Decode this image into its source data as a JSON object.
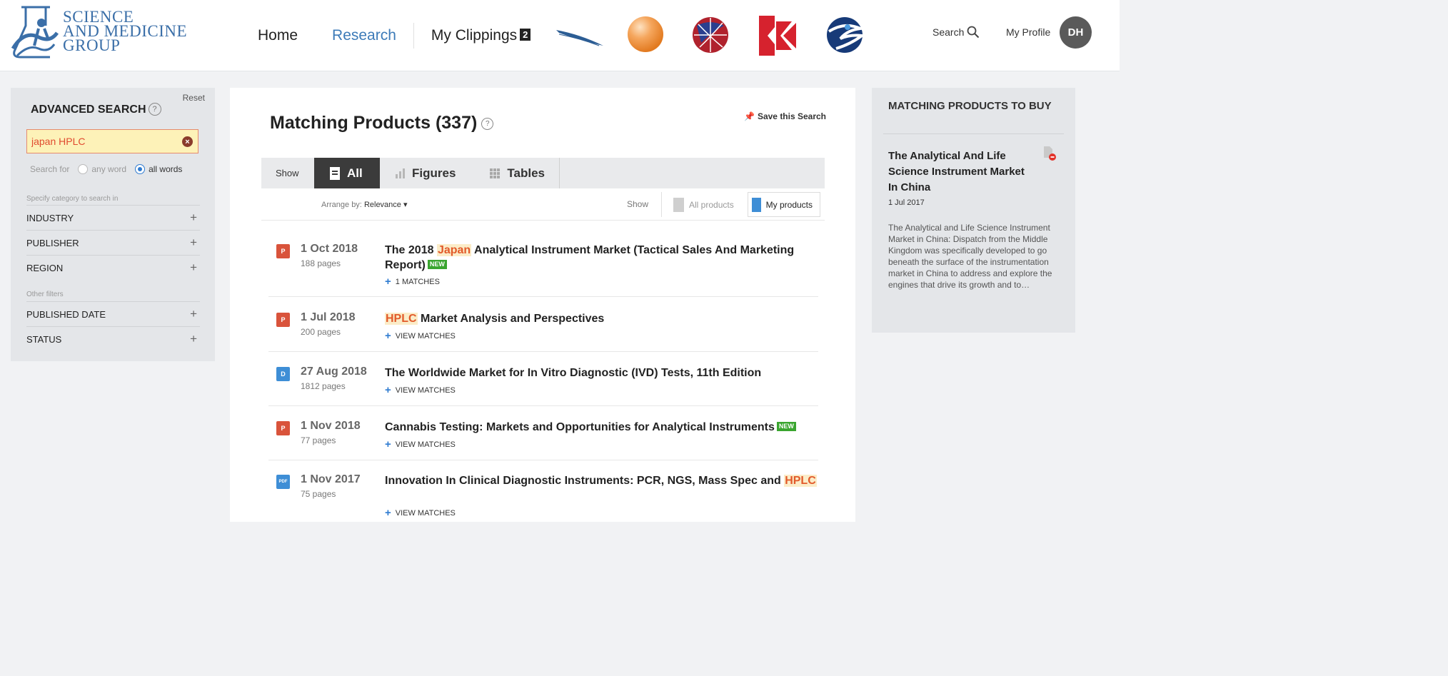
{
  "header": {
    "logo": {
      "line1": "SCIENCE",
      "line2": "AND MEDICINE",
      "line3": "GROUP"
    },
    "nav": {
      "home": "Home",
      "research": "Research",
      "clippings": "My Clippings",
      "clippings_count": "2"
    },
    "brands": [
      "wing-logo",
      "orange-sphere-logo",
      "globe-logo",
      "red-k-logo",
      "blue-swirl-logo"
    ],
    "search_label": "Search",
    "profile_label": "My Profile",
    "avatar_initials": "DH"
  },
  "left_panel": {
    "title": "ADVANCED SEARCH",
    "help": "?",
    "reset": "Reset",
    "search_value": "japan HPLC",
    "clear": "×",
    "search_for_label": "Search for",
    "option_any": "any word",
    "option_all": "all words",
    "category_label": "Specify category to search in",
    "filters": [
      "INDUSTRY",
      "PUBLISHER",
      "REGION"
    ],
    "other_label": "Other filters",
    "other_filters": [
      "PUBLISHED DATE",
      "STATUS"
    ],
    "plus": "+"
  },
  "main": {
    "title": "Matching Products (337)",
    "help": "?",
    "save_search": "Save this Search",
    "tabs": {
      "show": "Show",
      "all": "All",
      "figures": "Figures",
      "tables": "Tables"
    },
    "arrange_label": "Arrange by:",
    "arrange_value": "Relevance ▾",
    "show_label": "Show",
    "all_products": "All products",
    "my_products": "My products",
    "results": [
      {
        "type": "P",
        "date": "1 Oct 2018",
        "pages": "188 pages",
        "title_before": "The 2018 ",
        "title_hl": "Japan",
        "title_after": " Analytical Instrument Market (Tactical Sales And Marketing Report)",
        "new": "NEW",
        "matches": "1 MATCHES"
      },
      {
        "type": "P",
        "date": "1 Jul 2018",
        "pages": "200 pages",
        "title_hl": "HPLC",
        "title_after": " Market Analysis and Perspectives",
        "matches": "VIEW MATCHES"
      },
      {
        "type": "D",
        "date": "27 Aug 2018",
        "pages": "1812 pages",
        "title": "The Worldwide Market for In Vitro Diagnostic (IVD) Tests, 11th Edition",
        "matches": "VIEW MATCHES"
      },
      {
        "type": "P",
        "date": "1 Nov 2018",
        "pages": "77 pages",
        "title": "Cannabis Testing: Markets and Opportunities for Analytical Instruments",
        "new": "NEW",
        "matches": "VIEW MATCHES"
      },
      {
        "type": "PDF",
        "date": "1 Nov 2017",
        "pages": "75 pages",
        "title": "Innovation In Clinical Diagnostic Instruments: PCR, NGS, Mass Spec and ",
        "title_hl": "HPLC",
        "matches": "VIEW MATCHES"
      }
    ],
    "plus": "+"
  },
  "right_panel": {
    "title": "MATCHING PRODUCTS TO BUY",
    "product_title": "The Analytical And Life Science Instrument Market In China",
    "product_date": "1 Jul 2017",
    "product_desc": "The Analytical and Life Science Instrument Market in China: Dispatch from the Middle Kingdom was specifically developed to go beneath the surface of the instrumentation market in China to address and explore the engines that drive its growth and to…"
  },
  "colors": {
    "accent": "#3d7bb8",
    "highlight_text": "#e25a2a",
    "highlight_bg": "#fbecc8",
    "new_badge": "#3aa52f",
    "ppt": "#d9533b",
    "doc": "#3e8ed6"
  }
}
